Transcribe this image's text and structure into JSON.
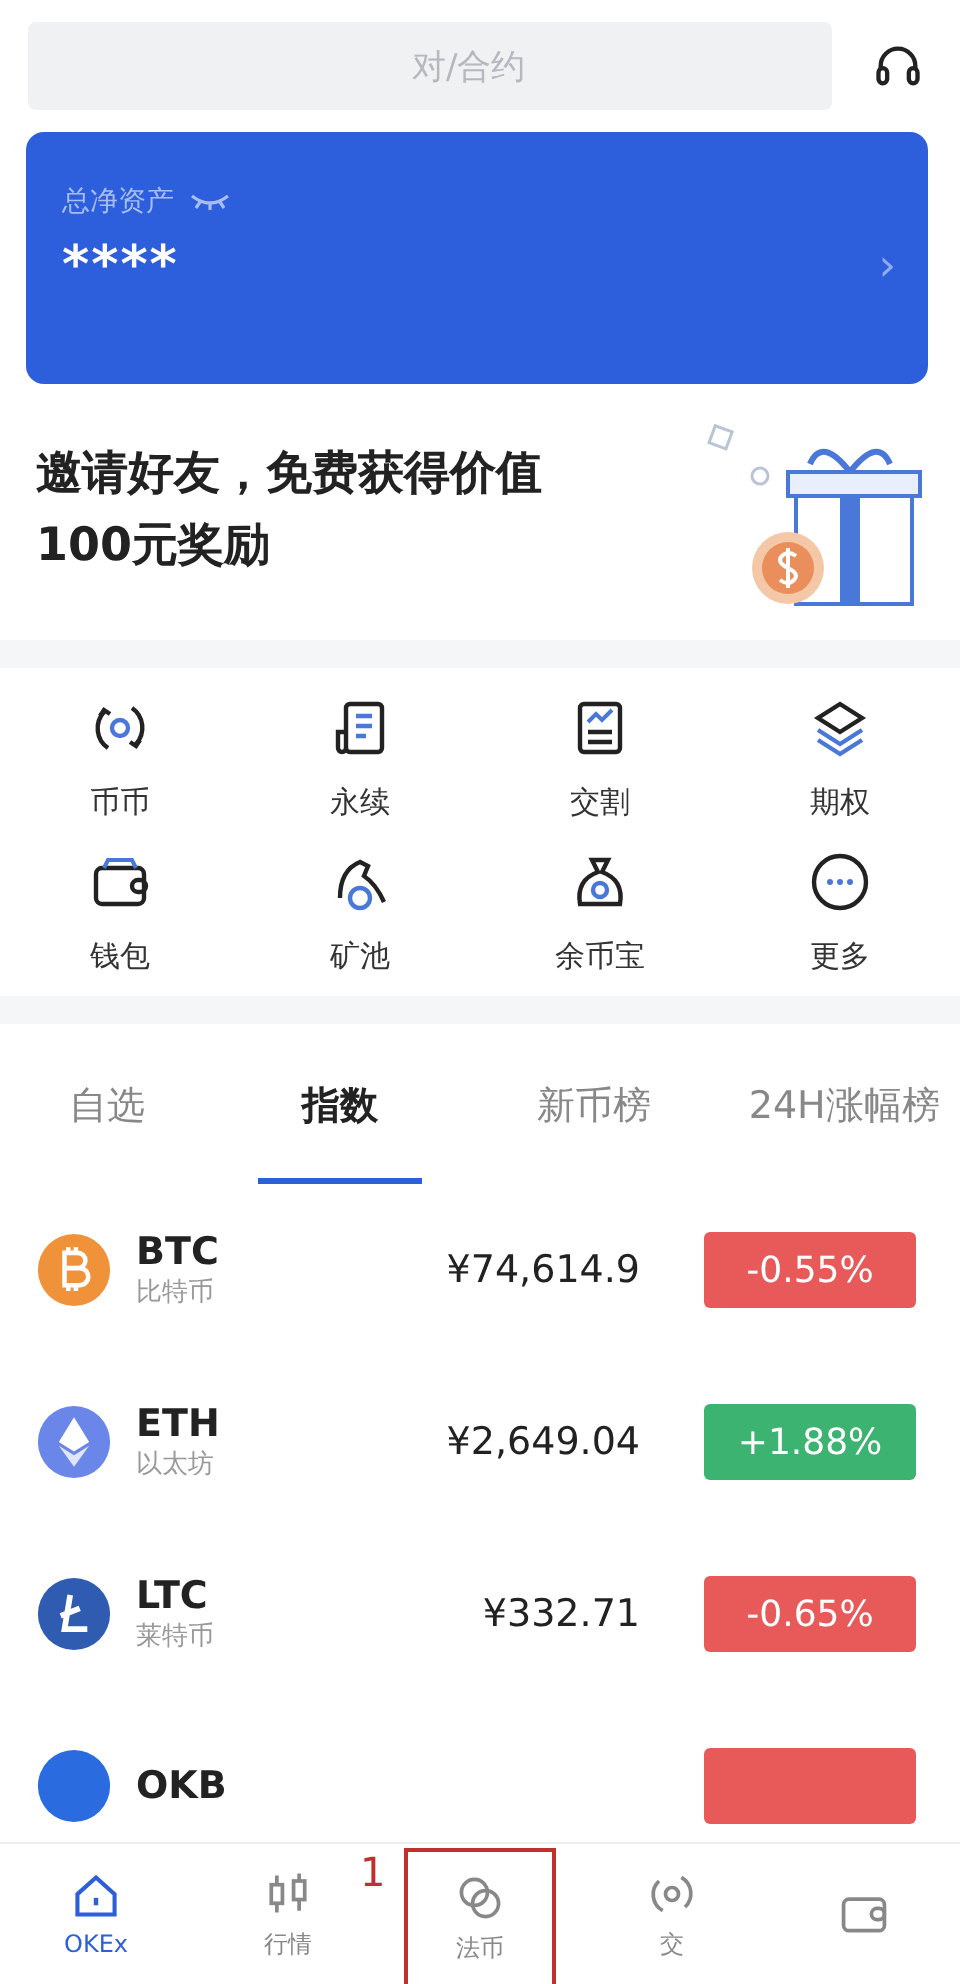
{
  "search": {
    "placeholder": "对/合约"
  },
  "assets": {
    "label": "总净资产",
    "value": "****",
    "hidden": true,
    "chevron": "›"
  },
  "banner": {
    "title": "邀请好友，免费获得价值100元奖励"
  },
  "shortcuts": [
    {
      "label": "币币",
      "kind": "swap"
    },
    {
      "label": "永续",
      "kind": "doc"
    },
    {
      "label": "交割",
      "kind": "chart"
    },
    {
      "label": "期权",
      "kind": "layers"
    },
    {
      "label": "钱包",
      "kind": "wallet"
    },
    {
      "label": "矿池",
      "kind": "pick"
    },
    {
      "label": "余币宝",
      "kind": "bag"
    },
    {
      "label": "更多",
      "kind": "more"
    }
  ],
  "tabs": [
    {
      "label": "自选",
      "selected": false
    },
    {
      "label": "指数",
      "selected": true
    },
    {
      "label": "新币榜",
      "selected": false
    },
    {
      "label": "24H涨幅榜",
      "selected": false
    }
  ],
  "coins": [
    {
      "symbol": "BTC",
      "name": "比特币",
      "price": "¥74,614.9",
      "change": "-0.55%",
      "up": false,
      "color": "#f0923a",
      "kind": "btc"
    },
    {
      "symbol": "ETH",
      "name": "以太坊",
      "price": "¥2,649.04",
      "change": "+1.88%",
      "up": true,
      "color": "#6a86e8",
      "kind": "eth"
    },
    {
      "symbol": "LTC",
      "name": "莱特币",
      "price": "¥332.71",
      "change": "-0.65%",
      "up": false,
      "color": "#2f5bb0",
      "kind": "ltc"
    },
    {
      "symbol": "OKB",
      "up": false,
      "color": "#2b6be0",
      "kind": "okb"
    }
  ],
  "nav": [
    {
      "label": "OKEx",
      "selected": true,
      "kind": "home",
      "highlighted": false
    },
    {
      "label": "行情",
      "selected": false,
      "kind": "candles",
      "highlighted": false
    },
    {
      "label": "法币",
      "selected": false,
      "kind": "coins",
      "highlighted": true
    },
    {
      "label": "交",
      "selected": false,
      "kind": "trade",
      "highlighted": false
    },
    {
      "selected": false,
      "kind": "wallet",
      "highlighted": false
    }
  ],
  "annotation": {
    "label": "1"
  }
}
